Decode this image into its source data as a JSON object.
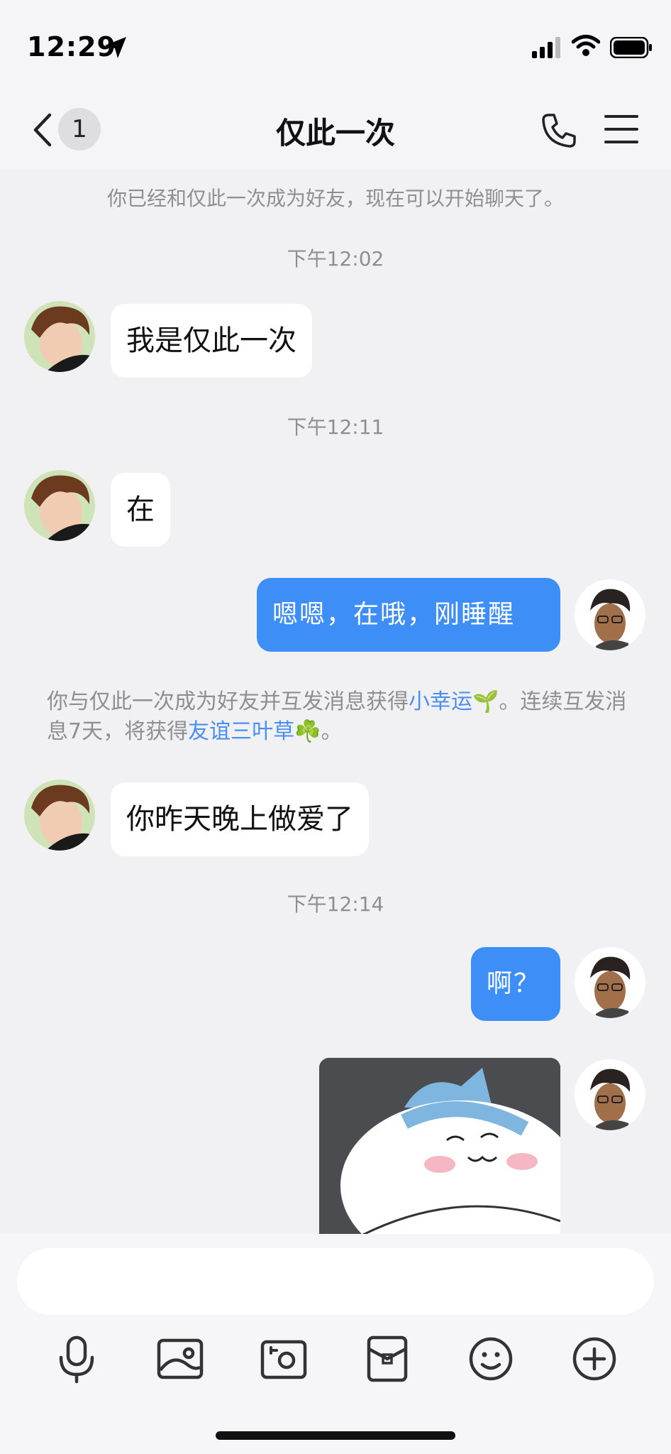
{
  "status": {
    "time": "12:29"
  },
  "header": {
    "back_count": "1",
    "title": "仅此一次"
  },
  "chat": {
    "system_friend": "你已经和仅此一次成为好友，现在可以开始聊天了。",
    "timestamps": [
      "下午12:02",
      "下午12:11",
      "下午12:14"
    ],
    "messages": [
      {
        "from": "friend",
        "text": "我是仅此一次"
      },
      {
        "from": "friend",
        "text": "在"
      },
      {
        "from": "me",
        "text": "嗯嗯，在哦，刚睡醒"
      },
      {
        "from": "friend",
        "text": "你昨天晚上做爱了"
      },
      {
        "from": "me",
        "text": "啊？"
      }
    ],
    "notice": {
      "part1": "你与仅此一次成为好友并互发消息获得",
      "link1": "小幸运",
      "part2": "。连续互发消息7天，将获得",
      "link2": "友谊三叶草",
      "part3": "。"
    },
    "sticker_icon": "cat-sticker"
  },
  "input": {
    "placeholder": "",
    "tools": [
      "microphone-icon",
      "image-icon",
      "camera-icon",
      "red-packet-icon",
      "emoji-icon",
      "plus-icon"
    ]
  },
  "colors": {
    "accent": "#3e8ef7",
    "link": "#4a8ff0",
    "background": "#f1f1f3"
  }
}
